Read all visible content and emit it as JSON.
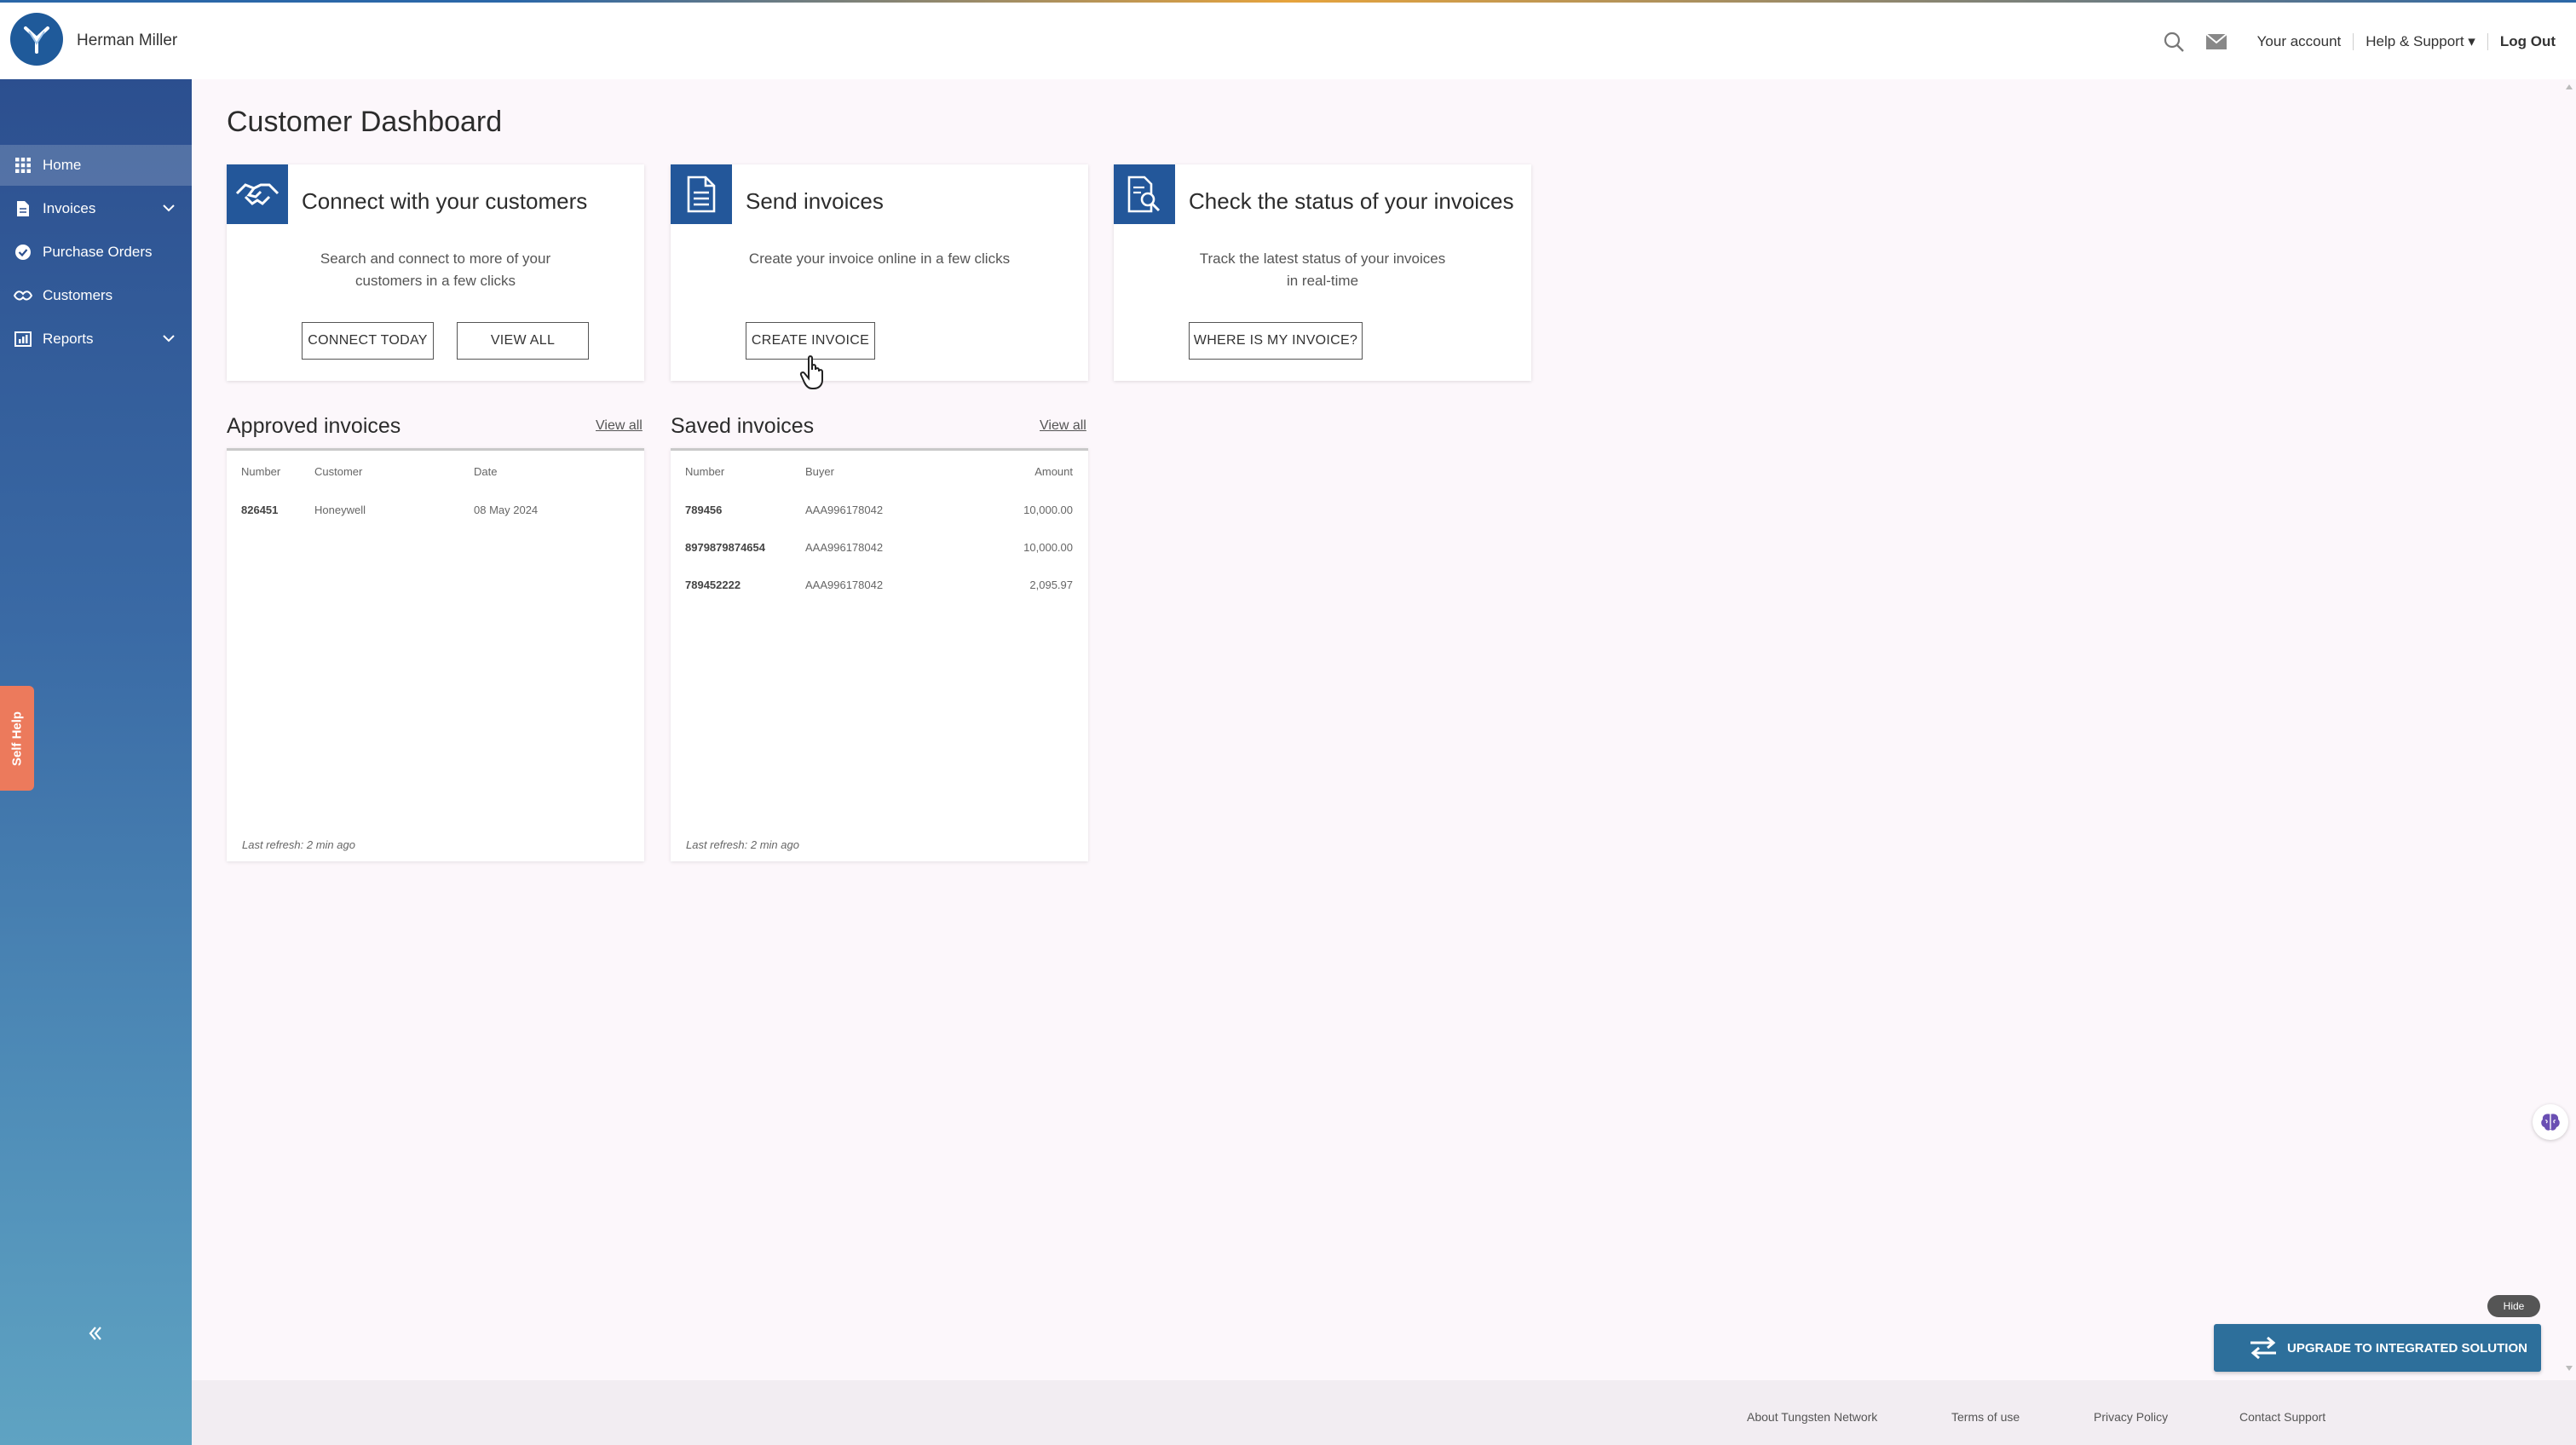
{
  "header": {
    "company_name": "Herman Miller",
    "your_account": "Your account",
    "help_support": "Help & Support",
    "log_out": "Log Out"
  },
  "sidebar": {
    "items": [
      {
        "label": "Home",
        "icon": "grid-icon"
      },
      {
        "label": "Invoices",
        "icon": "document-icon"
      },
      {
        "label": "Purchase Orders",
        "icon": "check-circle-icon"
      },
      {
        "label": "Customers",
        "icon": "handshake-icon"
      },
      {
        "label": "Reports",
        "icon": "report-icon"
      }
    ],
    "self_help": "Self Help"
  },
  "page_title": "Customer Dashboard",
  "cards": {
    "connect": {
      "title": "Connect with your customers",
      "desc_line1": "Search and connect to more of your",
      "desc_line2": "customers in a few clicks",
      "btn_connect": "CONNECT TODAY",
      "btn_viewall": "VIEW ALL"
    },
    "send": {
      "title": "Send invoices",
      "desc": "Create your invoice online in a few clicks",
      "btn_create": "CREATE INVOICE"
    },
    "status": {
      "title": "Check the status of your invoices",
      "desc_line1": "Track the latest status of your invoices",
      "desc_line2": "in real-time",
      "btn_where": "WHERE IS MY INVOICE?"
    }
  },
  "approved": {
    "title": "Approved invoices",
    "view_all": "View all",
    "columns": [
      "Number",
      "Customer",
      "Date"
    ],
    "rows": [
      {
        "number": "826451",
        "customer": "Honeywell",
        "date": "08 May 2024"
      }
    ],
    "last_refresh": "Last refresh: 2 min ago"
  },
  "saved": {
    "title": "Saved invoices",
    "view_all": "View all",
    "columns": [
      "Number",
      "Buyer",
      "Amount"
    ],
    "rows": [
      {
        "number": "789456",
        "buyer": "AAA996178042",
        "amount": "10,000.00"
      },
      {
        "number": "8979879874654",
        "buyer": "AAA996178042",
        "amount": "10,000.00"
      },
      {
        "number": "789452222",
        "buyer": "AAA996178042",
        "amount": "2,095.97"
      }
    ],
    "last_refresh": "Last refresh: 2 min ago"
  },
  "widgets": {
    "hide": "Hide",
    "upgrade": "UPGRADE TO INTEGRATED SOLUTION"
  },
  "footer": {
    "links": [
      "About Tungsten Network",
      "Terms of use",
      "Privacy Policy",
      "Contact Support"
    ]
  },
  "colors": {
    "primary": "#23579a",
    "sidebar_top": "#2c4f8f",
    "sidebar_bottom": "#5fa3c2",
    "self_help": "#ec7a5c",
    "upgrade_button": "#2d6f9b"
  }
}
